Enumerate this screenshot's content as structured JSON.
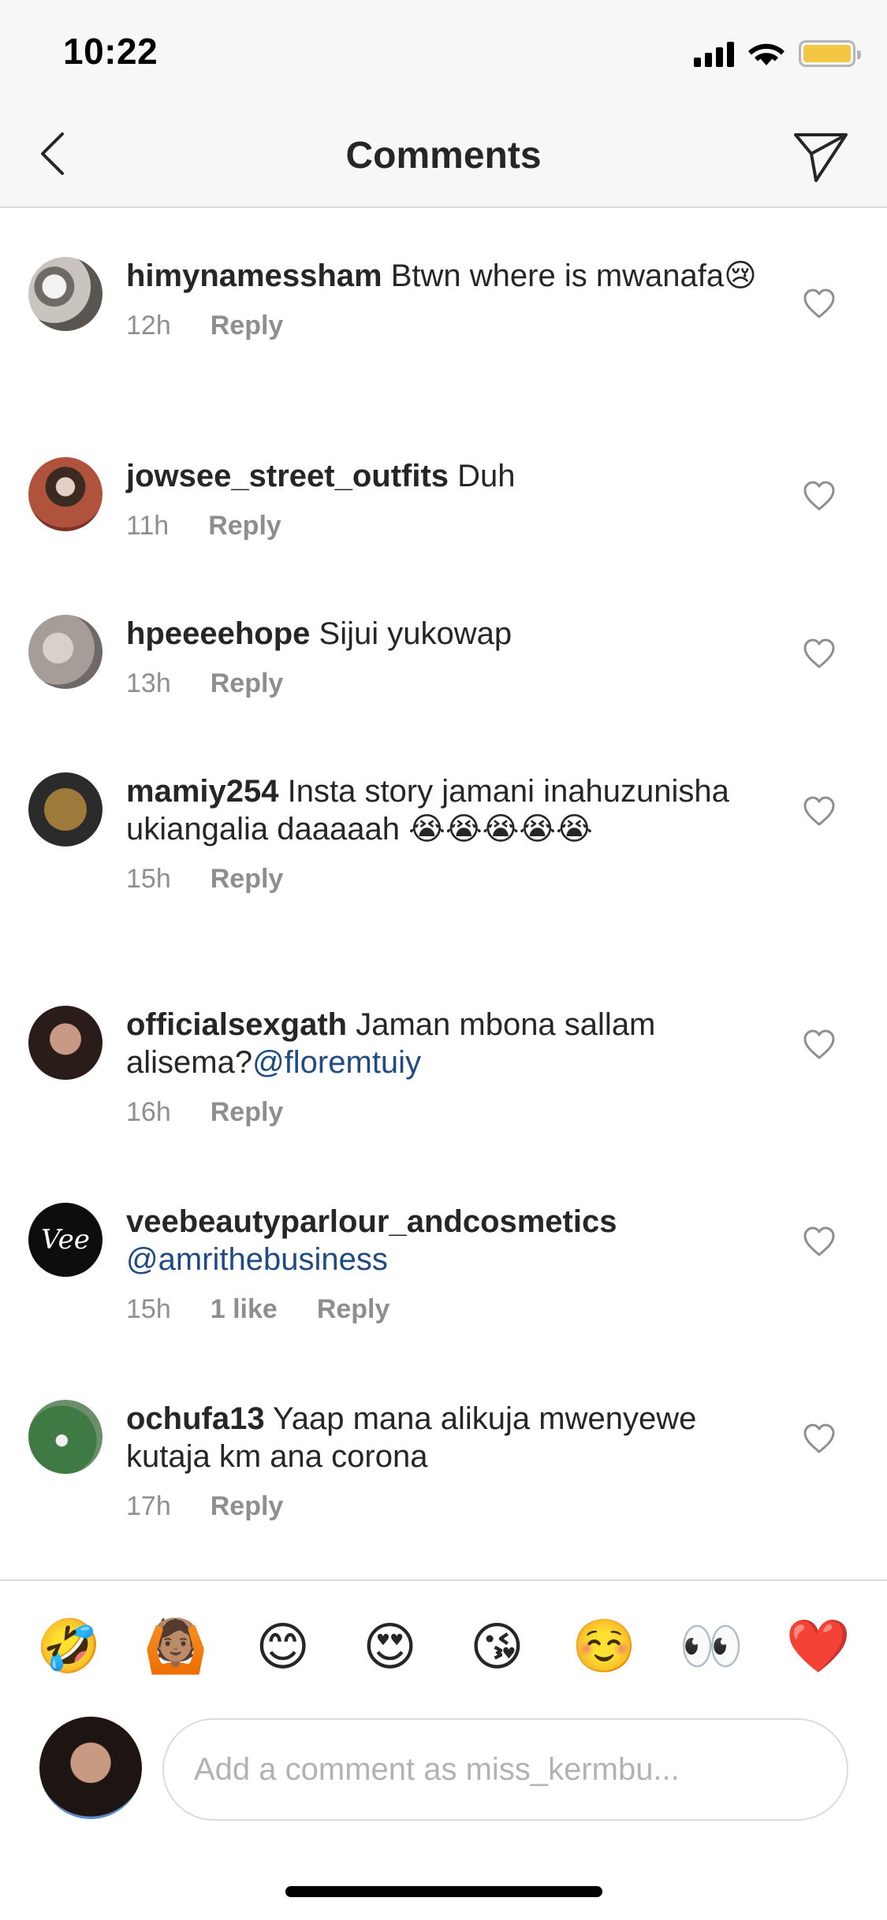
{
  "status_bar": {
    "time": "10:22",
    "icons": [
      "signal-icon",
      "wifi-icon",
      "battery-icon"
    ],
    "battery_color": "#f4c743"
  },
  "nav": {
    "title": "Comments",
    "back_icon": "chevron-left-icon",
    "share_icon": "paper-plane-icon"
  },
  "comments": [
    {
      "username": "himynamessham",
      "text": "Btwn where is mwanafa😢",
      "time": "12h",
      "reply_label": "Reply"
    },
    {
      "username": "jowsee_street_outfits",
      "text": "Duh",
      "time": "11h",
      "reply_label": "Reply"
    },
    {
      "username": "hpeeeehope",
      "text": "Sijui yukowap",
      "time": "13h",
      "reply_label": "Reply"
    },
    {
      "username": "mamiy254",
      "text": "Insta story jamani inahuzunisha ukiangalia daaaaah 😭😭😭😭😭",
      "time": "15h",
      "reply_label": "Reply"
    },
    {
      "username": "officialsexgath",
      "text": "Jaman mbona sallam alisema?",
      "mention": "@floremtuiy",
      "time": "16h",
      "reply_label": "Reply"
    },
    {
      "username": "veebeautyparlour_andcosmetics",
      "text": "",
      "mention": "@amrithebusiness",
      "time": "15h",
      "likes": "1 like",
      "reply_label": "Reply",
      "avatar_text": "Vee"
    },
    {
      "username": "ochufa13",
      "text": "Yaap mana alikuja mwenyewe kutaja km ana corona",
      "time": "17h",
      "reply_label": "Reply"
    }
  ],
  "emoji_bar": [
    "🤣",
    "🙆🏽",
    "😊",
    "😍",
    "😘",
    "☺️",
    "👀",
    "❤️"
  ],
  "input": {
    "placeholder": "Add a comment as miss_kermbu..."
  },
  "colors": {
    "mention": "#1f4a82",
    "meta_text": "#8e8e8e",
    "divider": "#dbdbdb",
    "heart_emoji": "#e0242c"
  }
}
